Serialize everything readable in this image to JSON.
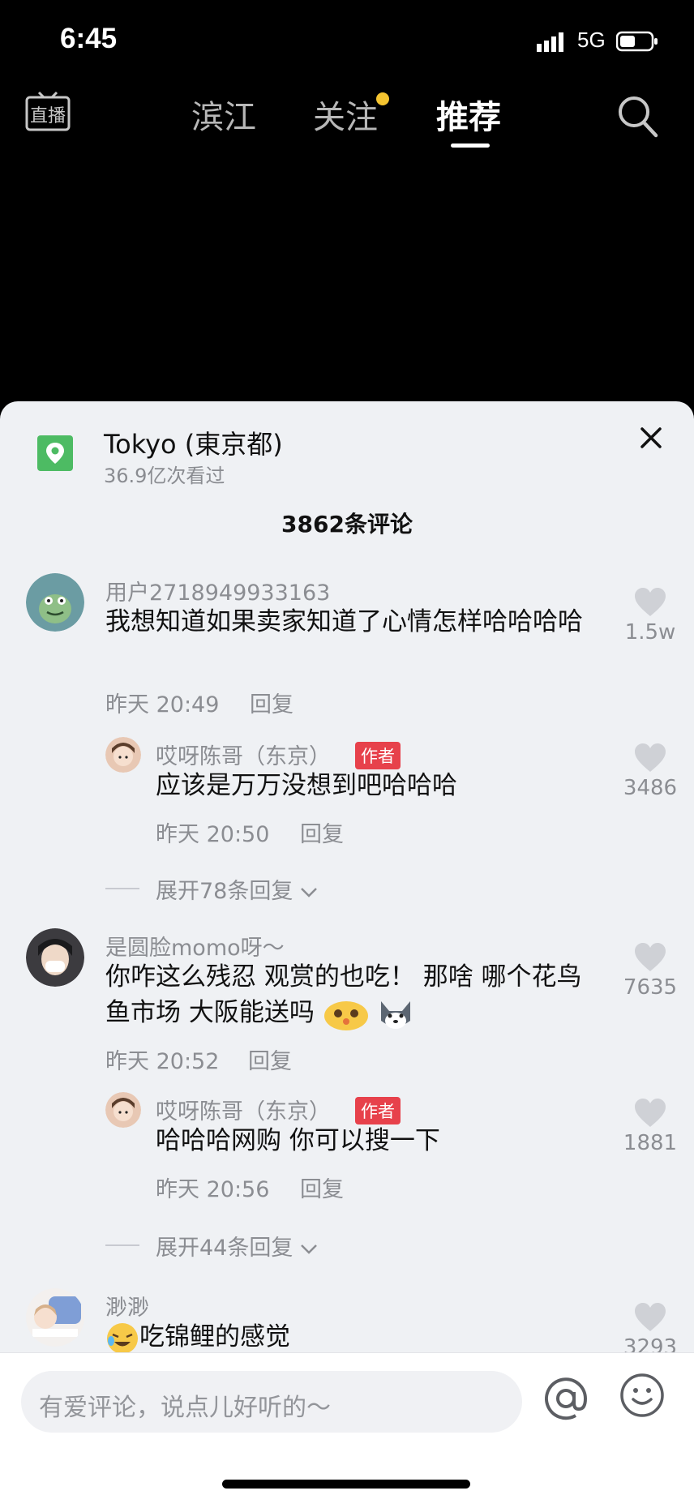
{
  "status": {
    "time": "6:45",
    "network": "5G"
  },
  "nav": {
    "tabs": [
      {
        "label": "滨江"
      },
      {
        "label": "关注"
      },
      {
        "label": "推荐"
      }
    ]
  },
  "location": {
    "title": "Tokyo (東京都)",
    "subtitle": "36.9亿次看过"
  },
  "comment_count": "3862条评论",
  "comments": [
    {
      "user": "用户2718949933163",
      "text": "我想知道如果卖家知道了心情怎样哈哈哈哈",
      "time": "昨天 20:49",
      "reply_label": "回复",
      "likes": "1.5w",
      "reply": {
        "user": "哎呀陈哥（东京）",
        "badge": "作者",
        "text": "应该是万万没想到吧哈哈哈",
        "time": "昨天 20:50",
        "reply_label": "回复",
        "likes": "3486"
      },
      "expand": "展开78条回复"
    },
    {
      "user": "是圆脸momo呀～",
      "text": "你咋这么残忍 观赏的也吃！ 那啥 哪个花鸟鱼市场 大阪能送吗",
      "time": "昨天 20:52",
      "reply_label": "回复",
      "likes": "7635",
      "reply": {
        "user": "哎呀陈哥（东京）",
        "badge": "作者",
        "text": "哈哈哈网购 你可以搜一下",
        "time": "昨天 20:56",
        "reply_label": "回复",
        "likes": "1881"
      },
      "expand": "展开44条回复"
    },
    {
      "user": "渺渺",
      "text": "吃锦鲤的感觉",
      "likes": "3293"
    }
  ],
  "input": {
    "placeholder": "有爱评论，说点儿好听的～"
  }
}
